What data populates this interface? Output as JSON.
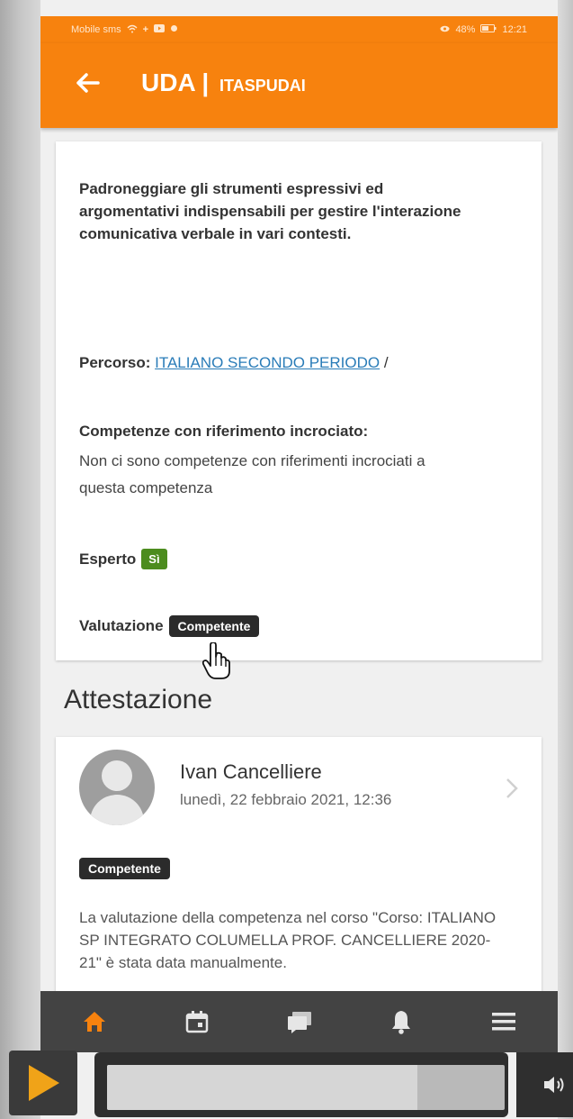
{
  "statusbar": {
    "carrier": "Mobile sms",
    "battery": "48%",
    "time": "12:21"
  },
  "appbar": {
    "title": "UDA",
    "separator": "|",
    "subtitle": "ITASPUDAI"
  },
  "competenza": {
    "description": "Padroneggiare gli strumenti espressivi ed argomentativi indispensabili per gestire l'interazione comunicativa verbale in vari contesti.",
    "percorso_label": "Percorso:",
    "percorso_link": "ITALIANO SECONDO PERIODO",
    "percorso_suffix": "/",
    "cross_ref_label": "Competenze con riferimento incrociato:",
    "cross_ref_text": "Non ci sono competenze con riferimenti incrociati a questa competenza",
    "esperto_label": "Esperto",
    "esperto_value": "Sì",
    "valutazione_label": "Valutazione",
    "valutazione_value": "Competente"
  },
  "attestazione": {
    "section_title": "Attestazione",
    "user_name": "Ivan Cancelliere",
    "date": "lunedì, 22 febbraio 2021, 12:36",
    "badge": "Competente",
    "text": "La valutazione della competenza nel corso \"Corso: ITALIANO SP INTEGRATO COLUMELLA PROF. CANCELLIERE 2020-21\" è stata data manualmente."
  },
  "bottom_nav": {
    "items": [
      {
        "icon": "home-icon",
        "active": true
      },
      {
        "icon": "calendar-icon",
        "active": false
      },
      {
        "icon": "messages-icon",
        "active": false
      },
      {
        "icon": "bell-icon",
        "active": false
      },
      {
        "icon": "menu-icon",
        "active": false
      }
    ]
  },
  "player": {
    "progress": 0.78
  },
  "colors": {
    "accent": "#f7820e",
    "link": "#2a7cb8",
    "badge_green": "#4c8c1e",
    "badge_dark": "#2b2b2b",
    "nav_bg": "#434343"
  }
}
